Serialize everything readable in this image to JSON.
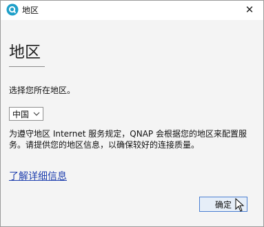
{
  "window": {
    "title": "地区",
    "app_icon": "qnap-q-icon",
    "close_label": "✕"
  },
  "main": {
    "heading": "地区",
    "prompt": "选择您所在地区。",
    "region_select": {
      "value": "中国"
    },
    "description": "为遵守地区 Internet 服务规定，QNAP 会根据您的地区来配置服务。请提供您的地区信息，以确保较好的连接质量。",
    "learn_more_link": "了解详细信息",
    "ok_button": "确定"
  },
  "colors": {
    "accent": "#4a7ed1",
    "link": "#1f3fae",
    "app_icon": "#1fa0c9"
  }
}
